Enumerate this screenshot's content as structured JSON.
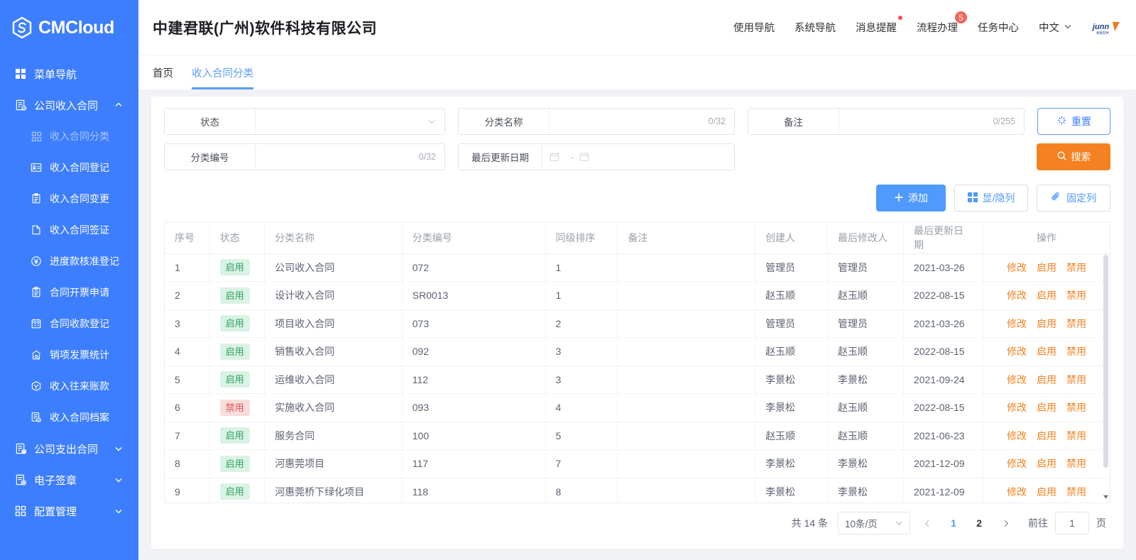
{
  "sidebar": {
    "logo_text": "CMCloud",
    "menu_nav_label": "菜单导航",
    "groups": [
      {
        "label": "公司收入合同",
        "expanded": true,
        "items": [
          {
            "label": "收入合同分类",
            "icon": "grid-icon",
            "active": true
          },
          {
            "label": "收入合同登记",
            "icon": "id-card-icon"
          },
          {
            "label": "收入合同变更",
            "icon": "clipboard-icon"
          },
          {
            "label": "收入合同签证",
            "icon": "page-fold-icon"
          },
          {
            "label": "进度款核准登记",
            "icon": "yuan-circle-icon"
          },
          {
            "label": "合同开票申请",
            "icon": "clipboard-icon"
          },
          {
            "label": "合同收款登记",
            "icon": "ledger-icon"
          },
          {
            "label": "销项发票统计",
            "icon": "invoice-icon"
          },
          {
            "label": "收入往来账款",
            "icon": "cube-icon"
          },
          {
            "label": "收入合同档案",
            "icon": "archive-icon"
          }
        ]
      },
      {
        "label": "公司支出合同",
        "expanded": false,
        "items": []
      },
      {
        "label": "电子签章",
        "expanded": false,
        "items": []
      },
      {
        "label": "配置管理",
        "expanded": false,
        "items": []
      }
    ]
  },
  "header": {
    "company_title": "中建君联(广州)软件科技有限公司",
    "links": [
      {
        "label": "使用导航",
        "badge": null,
        "badge_type": null
      },
      {
        "label": "系统导航",
        "badge": null,
        "badge_type": null
      },
      {
        "label": "消息提醒",
        "badge": "",
        "badge_type": "dot"
      },
      {
        "label": "流程办理",
        "badge": "5",
        "badge_type": "number"
      },
      {
        "label": "任务中心",
        "badge": null,
        "badge_type": null
      }
    ],
    "language": "中文",
    "brand_logo_text": "junny"
  },
  "tabs": [
    {
      "label": "首页",
      "active": false
    },
    {
      "label": "收入合同分类",
      "active": true
    }
  ],
  "filters": {
    "status": {
      "label": "状态",
      "value": "",
      "placeholder": ""
    },
    "category_name": {
      "label": "分类名称",
      "value": "",
      "counter": "0/32"
    },
    "remark": {
      "label": "备注",
      "value": "",
      "counter": "0/255"
    },
    "category_code": {
      "label": "分类编号",
      "value": "",
      "counter": "0/32"
    },
    "last_update_date": {
      "label": "最后更新日期",
      "start": "",
      "end": "",
      "separator": "-"
    },
    "reset_label": "重置",
    "search_label": "搜索"
  },
  "toolbar": {
    "add_label": "添加",
    "show_hide_columns_label": "显/隐列",
    "fixed_columns_label": "固定列"
  },
  "table": {
    "columns": [
      "序号",
      "状态",
      "分类名称",
      "分类编号",
      "同级排序",
      "备注",
      "创建人",
      "最后修改人",
      "最后更新日期",
      "操作"
    ],
    "op_labels": [
      "修改",
      "启用",
      "禁用"
    ],
    "rows": [
      {
        "idx": "1",
        "state": "启用",
        "state_type": "on",
        "name": "公司收入合同",
        "code": "072",
        "sort": "1",
        "remark": "",
        "creator": "管理员",
        "modifier": "管理员",
        "date": "2021-03-26"
      },
      {
        "idx": "2",
        "state": "启用",
        "state_type": "on",
        "name": "设计收入合同",
        "code": "SR0013",
        "sort": "1",
        "remark": "",
        "creator": "赵玉顺",
        "modifier": "赵玉顺",
        "date": "2022-08-15"
      },
      {
        "idx": "3",
        "state": "启用",
        "state_type": "on",
        "name": "项目收入合同",
        "code": "073",
        "sort": "2",
        "remark": "",
        "creator": "管理员",
        "modifier": "管理员",
        "date": "2021-03-26"
      },
      {
        "idx": "4",
        "state": "启用",
        "state_type": "on",
        "name": "销售收入合同",
        "code": "092",
        "sort": "3",
        "remark": "",
        "creator": "赵玉顺",
        "modifier": "赵玉顺",
        "date": "2022-08-15"
      },
      {
        "idx": "5",
        "state": "启用",
        "state_type": "on",
        "name": "运维收入合同",
        "code": "112",
        "sort": "3",
        "remark": "",
        "creator": "李景松",
        "modifier": "李景松",
        "date": "2021-09-24"
      },
      {
        "idx": "6",
        "state": "禁用",
        "state_type": "off",
        "name": "实施收入合同",
        "code": "093",
        "sort": "4",
        "remark": "",
        "creator": "李景松",
        "modifier": "赵玉顺",
        "date": "2022-08-15"
      },
      {
        "idx": "7",
        "state": "启用",
        "state_type": "on",
        "name": "服务合同",
        "code": "100",
        "sort": "5",
        "remark": "",
        "creator": "赵玉顺",
        "modifier": "赵玉顺",
        "date": "2021-06-23"
      },
      {
        "idx": "8",
        "state": "启用",
        "state_type": "on",
        "name": "河惠莞项目",
        "code": "117",
        "sort": "7",
        "remark": "",
        "creator": "李景松",
        "modifier": "李景松",
        "date": "2021-12-09"
      },
      {
        "idx": "9",
        "state": "启用",
        "state_type": "on",
        "name": "河惠莞桥下绿化项目",
        "code": "118",
        "sort": "8",
        "remark": "",
        "creator": "李景松",
        "modifier": "李景松",
        "date": "2021-12-09"
      }
    ]
  },
  "pagination": {
    "total_label": "共 14 条",
    "page_size": "10条/页",
    "pages": [
      "1",
      "2"
    ],
    "current_page": "1",
    "goto_label": "前往",
    "goto_value": "1",
    "page_unit": "页"
  },
  "colors": {
    "sidebar_blue": "#3d7eff",
    "accent_blue": "#4f9afc",
    "orange": "#f58220",
    "tag_on": "#2aa25c",
    "tag_off": "#e2504b"
  }
}
